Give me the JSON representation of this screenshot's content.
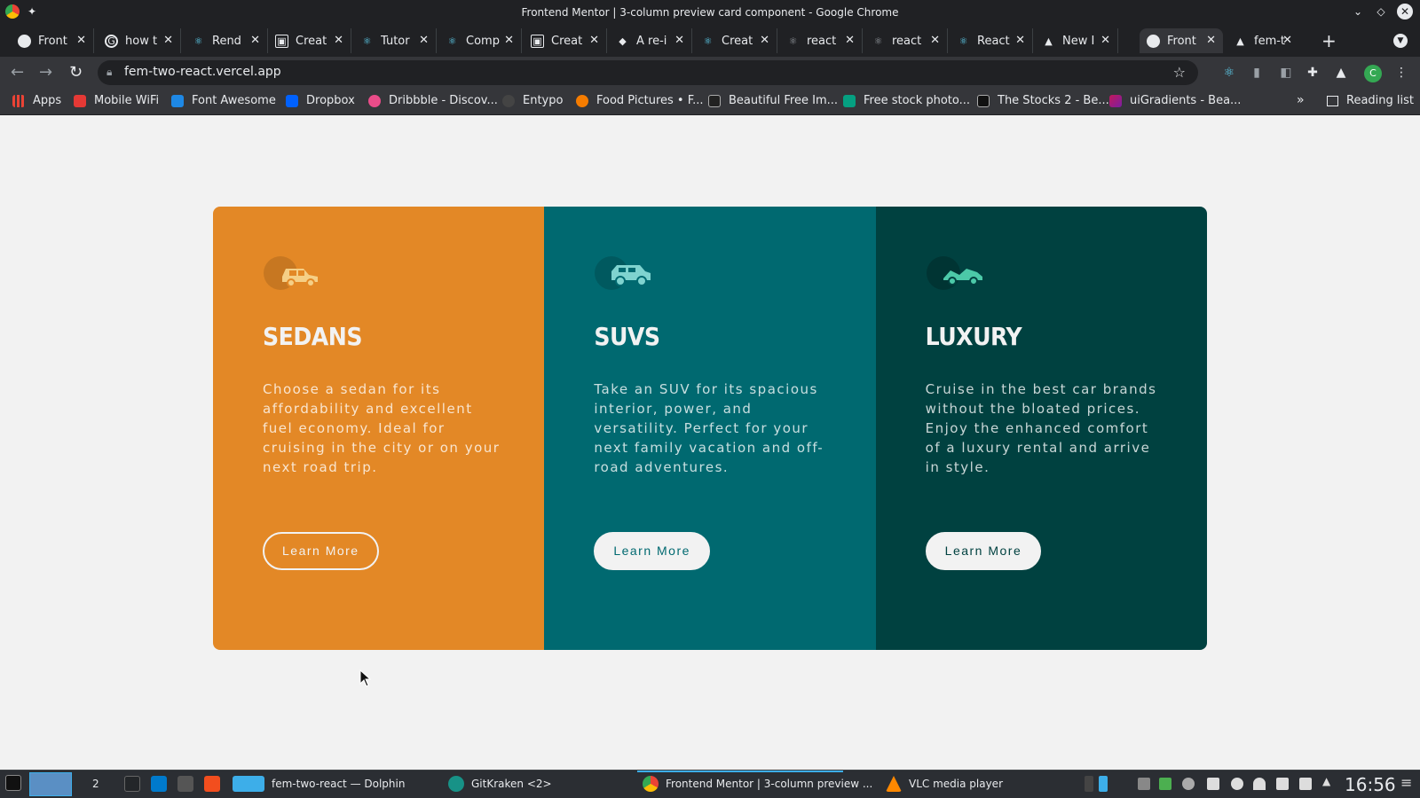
{
  "window": {
    "title": "Frontend Mentor | 3-column preview card component - Google Chrome"
  },
  "tabs": [
    {
      "label": "Front",
      "favicon": "white-circle-icon"
    },
    {
      "label": "how t",
      "favicon": "google-icon"
    },
    {
      "label": "Rend",
      "favicon": "react-icon"
    },
    {
      "label": "Creat",
      "favicon": "codesandbox-icon"
    },
    {
      "label": "Tutor",
      "favicon": "react-icon"
    },
    {
      "label": "Comp",
      "favicon": "react-icon"
    },
    {
      "label": "Creat",
      "favicon": "codesandbox-icon"
    },
    {
      "label": "A re-i",
      "favicon": "tag-icon"
    },
    {
      "label": "Creat",
      "favicon": "react-icon"
    },
    {
      "label": "react",
      "favicon": "react-icon"
    },
    {
      "label": "react",
      "favicon": "react-icon"
    },
    {
      "label": "React",
      "favicon": "react-icon"
    },
    {
      "label": "New I",
      "favicon": "vercel-icon"
    },
    {
      "label": "Front",
      "favicon": "white-circle-icon",
      "active": true
    },
    {
      "label": "fem-t",
      "favicon": "vercel-icon"
    }
  ],
  "address": {
    "url": "fem-two-react.vercel.app"
  },
  "profile_initial": "C",
  "bookmarks": [
    {
      "label": "Apps",
      "color": "#ea4335"
    },
    {
      "label": "Mobile WiFi",
      "color": "#e53935"
    },
    {
      "label": "Font Awesome",
      "color": "#1e88e5"
    },
    {
      "label": "Dropbox",
      "color": "#0061fe"
    },
    {
      "label": "Dribbble - Discov...",
      "color": "#ea4c89"
    },
    {
      "label": "Entypo",
      "color": "#444444"
    },
    {
      "label": "Food Pictures • F...",
      "color": "#f57c00"
    },
    {
      "label": "Beautiful Free Im...",
      "color": "#222222"
    },
    {
      "label": "Free stock photo...",
      "color": "#05a081"
    },
    {
      "label": "The Stocks 2 - Be...",
      "color": "#111111"
    },
    {
      "label": "uiGradients - Bea...",
      "color": "#c2185b"
    }
  ],
  "reading_list": "Reading list",
  "cards": [
    {
      "title": "SEDANS",
      "description": "Choose a sedan for its affordability and excellent fuel economy. Ideal for cruising in the city or on your next road trip.",
      "button": "Learn More",
      "bg": "#e38826",
      "icon_color": "#f5cf86",
      "btn_color": "#e38826"
    },
    {
      "title": "SUVS",
      "description": "Take an SUV for its spacious interior, power, and versatility. Perfect for your next family vacation and off-road adventures.",
      "button": "Learn More",
      "bg": "#006970",
      "icon_color": "#7fd3cf",
      "btn_color": "#006970"
    },
    {
      "title": "LUXURY",
      "description": "Cruise in the best car brands without the bloated prices. Enjoy the enhanced comfort of a luxury rental and arrive in style.",
      "button": "Learn More",
      "bg": "#004140",
      "icon_color": "#4cc9a8",
      "btn_color": "#004140"
    }
  ],
  "taskbar": {
    "pager_number": "2",
    "items": [
      {
        "label": "fem-two-react — Dolphin"
      },
      {
        "label": "GitKraken <2>"
      },
      {
        "label": "Frontend Mentor | 3-column preview ..."
      },
      {
        "label": "VLC media player"
      }
    ],
    "clock": "16:56"
  }
}
